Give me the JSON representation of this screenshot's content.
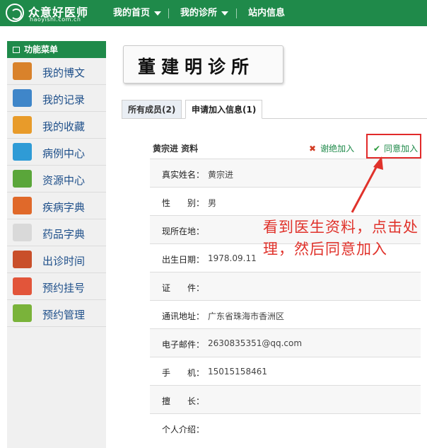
{
  "brand": {
    "title": "众意好医师",
    "url": "haoyishi.com.cn"
  },
  "nav": [
    {
      "label": "我的首页"
    },
    {
      "label": "我的诊所"
    },
    {
      "label": "站内信息"
    }
  ],
  "sidebar": {
    "header": "功能菜单",
    "items": [
      {
        "label": "我的博文",
        "icon": "at-sign-icon",
        "color": "#d9822b"
      },
      {
        "label": "我的记录",
        "icon": "notepad-icon",
        "color": "#3f86c9"
      },
      {
        "label": "我的收藏",
        "icon": "favorites-icon",
        "color": "#e89b2a"
      },
      {
        "label": "病例中心",
        "icon": "clipboard-icon",
        "color": "#2f9bd6"
      },
      {
        "label": "资源中心",
        "icon": "picture-icon",
        "color": "#5aa63a"
      },
      {
        "label": "疾病字典",
        "icon": "starburst-icon",
        "color": "#e0692a"
      },
      {
        "label": "药品字典",
        "icon": "pills-icon",
        "color": "#d9d9d9"
      },
      {
        "label": "出诊时间",
        "icon": "alarm-clock-icon",
        "color": "#c94f2a"
      },
      {
        "label": "预约挂号",
        "icon": "number-badge-icon",
        "color": "#e2553a"
      },
      {
        "label": "预约管理",
        "icon": "clock-icon",
        "color": "#7ab33a"
      }
    ]
  },
  "clinic": {
    "name": "董建明诊所"
  },
  "tabs": [
    {
      "label": "所有成员(2)"
    },
    {
      "label": "申请加入信息(1)"
    }
  ],
  "applicant": {
    "header": "黄宗进  资料",
    "reject_label": "谢绝加入",
    "accept_label": "同意加入",
    "fields": [
      {
        "key": "真实姓名：",
        "value": "黄宗进"
      },
      {
        "key": "性　　别：",
        "value": "男"
      },
      {
        "key": "现所在地：",
        "value": ""
      },
      {
        "key": "出生日期：",
        "value": "1978.09.11"
      },
      {
        "key": "证　　件：",
        "value": ""
      },
      {
        "key": "通讯地址：",
        "value": "广东省珠海市香洲区"
      },
      {
        "key": "电子邮件：",
        "value": "2630835351@qq.com"
      },
      {
        "key": "手　　机：",
        "value": "15015158461"
      },
      {
        "key": "擅　　长：",
        "value": ""
      },
      {
        "key": "个人介绍：",
        "value": ""
      }
    ]
  },
  "annotation": {
    "text": "看到医生资料，点击处理，然后同意加入",
    "color": "#e0322b"
  }
}
